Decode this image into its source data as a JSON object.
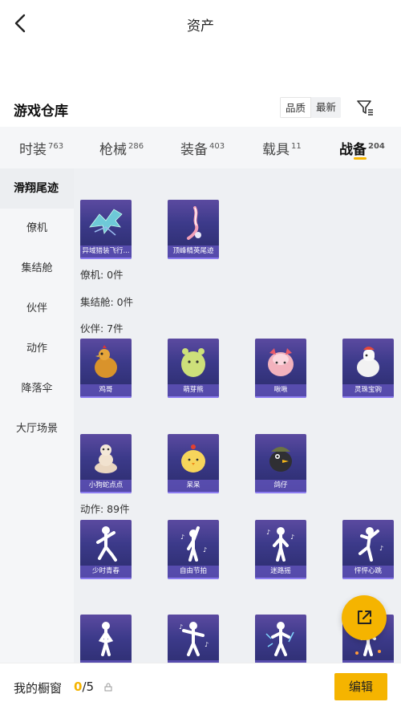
{
  "header": {
    "title": "资产"
  },
  "warehouse": {
    "title": "游戏仓库",
    "sort_options": [
      "品质",
      "最新"
    ]
  },
  "tabs": [
    {
      "label": "时装",
      "count": "763"
    },
    {
      "label": "枪械",
      "count": "286"
    },
    {
      "label": "装备",
      "count": "403"
    },
    {
      "label": "载具",
      "count": "11"
    },
    {
      "label": "战备",
      "count": "204"
    }
  ],
  "sidebar": {
    "items": [
      "滑翔尾迹",
      "僚机",
      "集结舱",
      "伙伴",
      "动作",
      "降落伞",
      "大厅场景"
    ]
  },
  "sections": {
    "trails": {
      "items": [
        "异域猎装飞行...",
        "顶峰精英尾迹"
      ]
    },
    "wingman": {
      "label": "僚机: 0件"
    },
    "pod": {
      "label": "集结舱: 0件"
    },
    "partner": {
      "label": "伙伴: 7件",
      "items": [
        "鸡哥",
        "萌芽熊",
        "啾啾",
        "灵珠宝驹",
        "小狗蛇点点",
        "呆呆",
        "鸽仔"
      ]
    },
    "emote": {
      "label": "动作: 89件",
      "items": [
        "少时青春",
        "自由节拍",
        "迷路摇",
        "怦怦心跳",
        "",
        "",
        "",
        ""
      ]
    }
  },
  "bottom": {
    "label": "我的橱窗",
    "current": "0",
    "total": "/5",
    "edit_label": "编辑"
  },
  "colors": {
    "accent": "#f5b400",
    "card": "#3c3a8a"
  }
}
